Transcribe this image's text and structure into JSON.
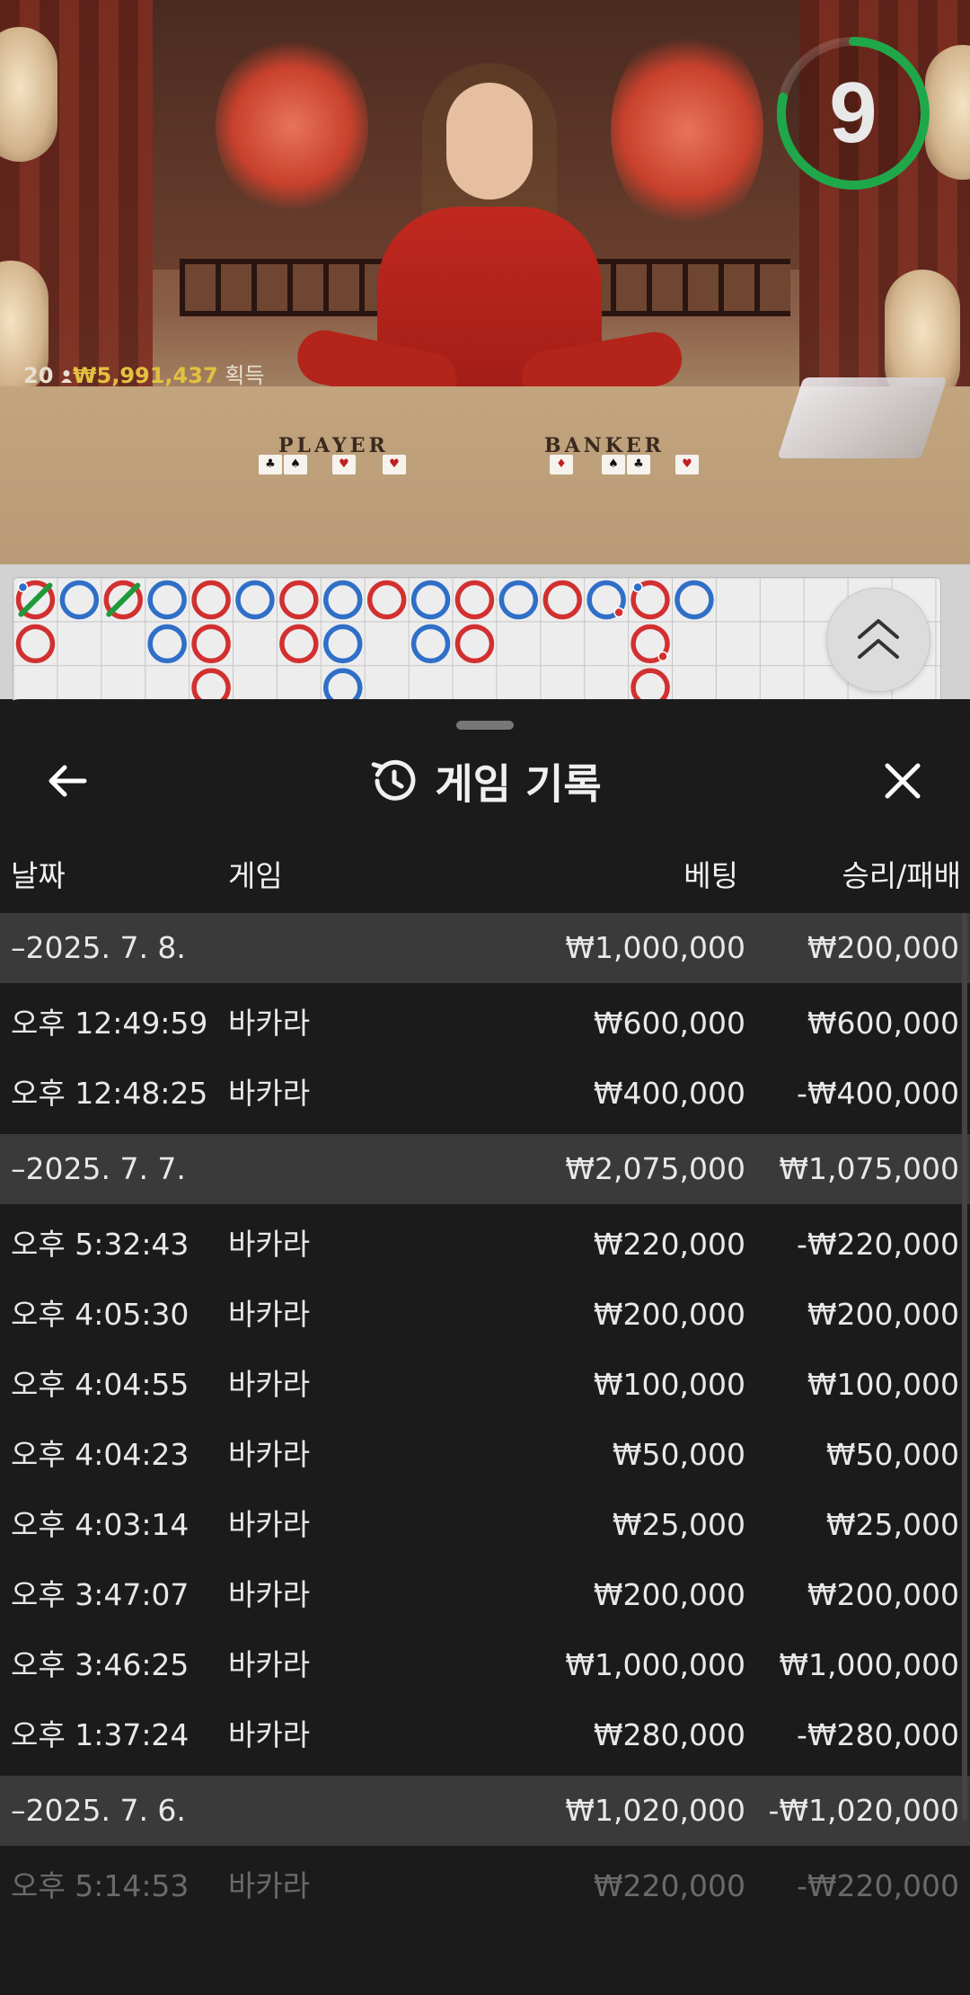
{
  "video": {
    "timer_value": "9",
    "winner_count": "20",
    "winner_amount": "₩5,991,437",
    "winner_suffix": "획득",
    "player_label": "PLAYER",
    "banker_label": "BANKER",
    "timer_color": "#1fa84a"
  },
  "roadmap": {
    "columns": [
      [
        {
          "c": "R",
          "tie": true,
          "pp": true
        },
        {
          "c": "R"
        }
      ],
      [
        {
          "c": "B"
        }
      ],
      [
        {
          "c": "R",
          "tie": true
        }
      ],
      [
        {
          "c": "B"
        },
        {
          "c": "B"
        }
      ],
      [
        {
          "c": "R"
        },
        {
          "c": "R"
        },
        {
          "c": "R"
        }
      ],
      [
        {
          "c": "B"
        }
      ],
      [
        {
          "c": "R"
        },
        {
          "c": "R"
        }
      ],
      [
        {
          "c": "B"
        },
        {
          "c": "B"
        },
        {
          "c": "B"
        }
      ],
      [
        {
          "c": "R"
        }
      ],
      [
        {
          "c": "B"
        },
        {
          "c": "B"
        }
      ],
      [
        {
          "c": "R"
        },
        {
          "c": "R"
        }
      ],
      [
        {
          "c": "B"
        }
      ],
      [
        {
          "c": "R"
        }
      ],
      [
        {
          "c": "B",
          "bp": true
        }
      ],
      [
        {
          "c": "R",
          "pp": true
        },
        {
          "c": "R",
          "bp": true
        },
        {
          "c": "R"
        }
      ],
      [
        {
          "c": "B"
        }
      ]
    ],
    "red_color": "#d23030",
    "blue_color": "#2f6fc8",
    "tie_color": "#1f9a3a"
  },
  "sheet": {
    "title": "게임 기록",
    "icons": {
      "back": "arrow-left-icon",
      "history": "history-clock-icon",
      "close": "close-icon"
    },
    "headers": {
      "date": "날짜",
      "game": "게임",
      "bet": "베팅",
      "win": "승리/패배"
    },
    "groups": [
      {
        "date": "–2025. 7. 8.",
        "bet": "₩1,000,000",
        "win": "₩200,000",
        "items": [
          {
            "time": "오후 12:49:59",
            "game": "바카라",
            "bet": "₩600,000",
            "win": "₩600,000"
          },
          {
            "time": "오후 12:48:25",
            "game": "바카라",
            "bet": "₩400,000",
            "win": "-₩400,000"
          }
        ]
      },
      {
        "date": "–2025. 7. 7.",
        "bet": "₩2,075,000",
        "win": "₩1,075,000",
        "items": [
          {
            "time": "오후 5:32:43",
            "game": "바카라",
            "bet": "₩220,000",
            "win": "-₩220,000"
          },
          {
            "time": "오후 4:05:30",
            "game": "바카라",
            "bet": "₩200,000",
            "win": "₩200,000"
          },
          {
            "time": "오후 4:04:55",
            "game": "바카라",
            "bet": "₩100,000",
            "win": "₩100,000"
          },
          {
            "time": "오후 4:04:23",
            "game": "바카라",
            "bet": "₩50,000",
            "win": "₩50,000"
          },
          {
            "time": "오후 4:03:14",
            "game": "바카라",
            "bet": "₩25,000",
            "win": "₩25,000"
          },
          {
            "time": "오후 3:47:07",
            "game": "바카라",
            "bet": "₩200,000",
            "win": "₩200,000"
          },
          {
            "time": "오후 3:46:25",
            "game": "바카라",
            "bet": "₩1,000,000",
            "win": "₩1,000,000"
          },
          {
            "time": "오후 1:37:24",
            "game": "바카라",
            "bet": "₩280,000",
            "win": "-₩280,000"
          }
        ]
      },
      {
        "date": "–2025. 7. 6.",
        "bet": "₩1,020,000",
        "win": "-₩1,020,000",
        "items": [
          {
            "time": "오후 5:14:53",
            "game": "바카라",
            "bet": "₩220,000",
            "win": "-₩220,000"
          }
        ]
      }
    ]
  }
}
